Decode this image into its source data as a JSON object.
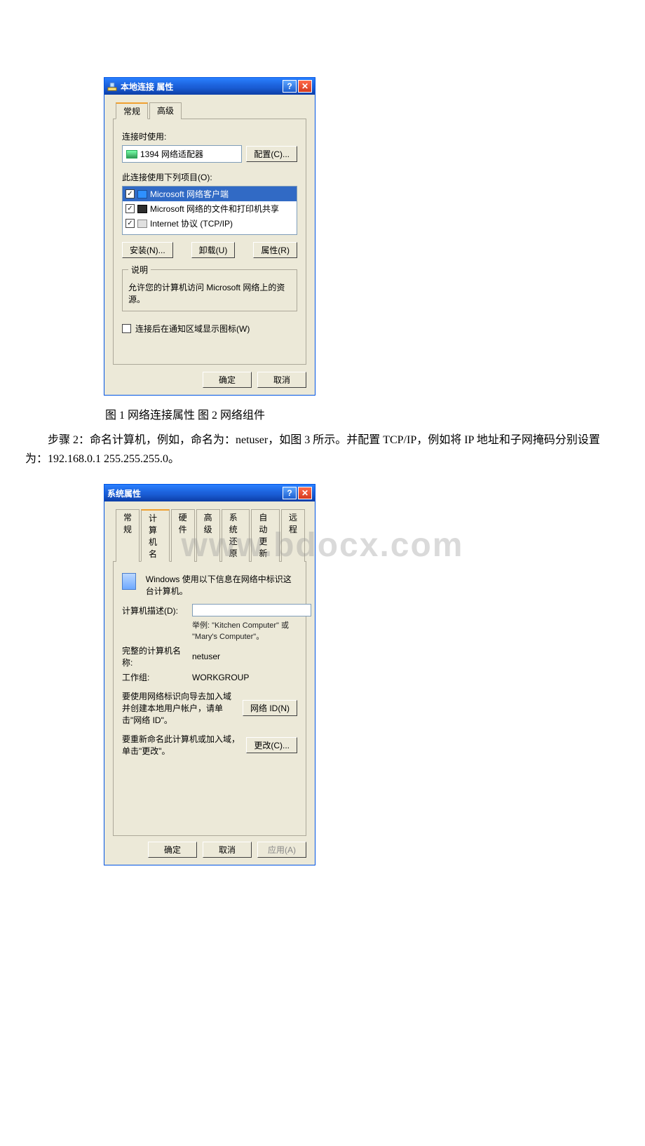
{
  "watermark": "www.bdocx.com",
  "dialog1": {
    "title": "本地连接  属性",
    "tabs": {
      "general": "常规",
      "advanced": "高级"
    },
    "connect_using_label": "连接时使用:",
    "adapter": "1394 网络适配器",
    "configure_btn": "配置(C)...",
    "items_label": "此连接使用下列项目(O):",
    "items": [
      {
        "checked": true,
        "selected": true,
        "name": "Microsoft 网络客户端"
      },
      {
        "checked": true,
        "selected": false,
        "name": "Microsoft 网络的文件和打印机共享"
      },
      {
        "checked": true,
        "selected": false,
        "name": "Internet 协议 (TCP/IP)"
      }
    ],
    "install_btn": "安装(N)...",
    "uninstall_btn": "卸载(U)",
    "properties_btn": "属性(R)",
    "description_legend": "说明",
    "description_text": "允许您的计算机访问 Microsoft 网络上的资源。",
    "show_icon_checkbox": "连接后在通知区域显示图标(W)",
    "ok_btn": "确定",
    "cancel_btn": "取消"
  },
  "caption1": "图 1 网络连接属性 图 2 网络组件",
  "para": "步骤 2：命名计算机，例如，命名为：netuser，如图 3 所示。并配置 TCP/IP，例如将 IP 地址和子网掩码分别设置为：192.168.0.1 255.255.255.0。",
  "dialog2": {
    "title": "系统属性",
    "tabs": {
      "general": "常规",
      "computer_name": "计算机名",
      "hardware": "硬件",
      "advanced": "高级",
      "restore": "系统还原",
      "autoupdate": "自动更新",
      "remote": "远程"
    },
    "intro": "Windows 使用以下信息在网络中标识这台计算机。",
    "desc_label": "计算机描述(D):",
    "desc_value": "",
    "desc_example": "举例: \"Kitchen Computer\" 或 \"Mary's Computer\"。",
    "fullname_label": "完整的计算机名称:",
    "fullname_value": "netuser",
    "workgroup_label": "工作组:",
    "workgroup_value": "WORKGROUP",
    "wizard_text": "要使用网络标识向导去加入域并创建本地用户帐户，请单击\"网络 ID\"。",
    "wizard_btn": "网络 ID(N)",
    "rename_text": "要重新命名此计算机或加入域，单击\"更改\"。",
    "rename_btn": "更改(C)...",
    "ok_btn": "确定",
    "cancel_btn": "取消",
    "apply_btn": "应用(A)"
  }
}
